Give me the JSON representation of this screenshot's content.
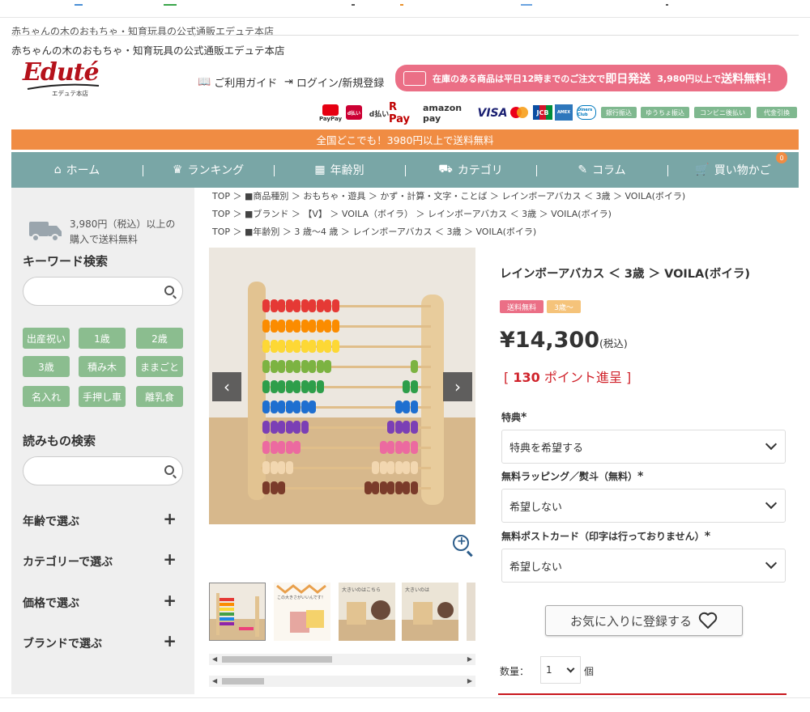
{
  "header": {
    "tagline_faint": "赤ちゃんの木のおもちゃ・知育玩具の公式通販エデュテ本店",
    "tagline": "赤ちゃんの木のおもちゃ・知育玩具の公式通販エデュテ本店",
    "logo_text": "Eduté",
    "logo_sub": "エデュテ本店",
    "guide_link": "ご利用ガイド",
    "login_link": "ログイン/新規登録",
    "promo": {
      "part1": "在庫のある商品は平日12時までのご注文で",
      "part2": "即日発送",
      "part3": "3,980円以上で",
      "part4": "送料無料！"
    },
    "payments": [
      "PayPay",
      "d払い",
      "d払い",
      "R Pay",
      "amazon pay",
      "VISA",
      "mastercard",
      "JCB",
      "AMEX",
      "Diners Club"
    ],
    "payment_badges": [
      "銀行振込",
      "ゆうちょ振込",
      "コンビニ後払い",
      "代金引換"
    ]
  },
  "shipping_banner": "全国どこでも！3980円以上で送料無料",
  "nav": {
    "items": [
      {
        "label": "ホーム",
        "icon": "home-icon"
      },
      {
        "label": "ランキング",
        "icon": "crown-icon"
      },
      {
        "label": "年齢別",
        "icon": "calendar-icon"
      },
      {
        "label": "カテゴリ",
        "icon": "truck-icon"
      },
      {
        "label": "コラム",
        "icon": "pencil-icon"
      },
      {
        "label": "買い物かご",
        "icon": "cart-icon"
      }
    ],
    "cart_count": "0"
  },
  "sidebar": {
    "shipping_note_1": "3,980円（税込）以上の",
    "shipping_note_2": "購入で送料無料",
    "keyword_heading": "キーワード検索",
    "keyword_placeholder": "",
    "tags": [
      "出産祝い",
      "1歳",
      "2歳",
      "3歳",
      "積み木",
      "ままごと",
      "名入れ",
      "手押し車",
      "離乳食"
    ],
    "reading_heading": "読みもの検索",
    "reading_placeholder": "",
    "accordions": [
      "年齢で選ぶ",
      "カテゴリーで選ぶ",
      "価格で選ぶ",
      "ブランドで選ぶ"
    ]
  },
  "breadcrumbs": [
    "TOP ＞ ■商品種別 ＞ おもちゃ・遊具 ＞ かず・計算・文字・ことば ＞ レインボーアバカス ＜ 3歳 ＞ VOILA(ボイラ)",
    "TOP ＞ ■ブランド ＞ 【V】 ＞ VOILA（ボイラ） ＞ レインボーアバカス ＜ 3歳 ＞ VOILA(ボイラ)",
    "TOP ＞ ■年齢別 ＞ 3 歳～4 歳 ＞ レインボーアバカス ＜ 3歳 ＞ VOILA(ボイラ)"
  ],
  "product": {
    "title": "レインボーアバカス ＜ 3歳 ＞ VOILA(ボイラ)",
    "badge_free_shipping": "送料無料",
    "badge_age": "3歳～",
    "price": "¥14,300",
    "tax_note": "(税込)",
    "points_open": "[",
    "points_value": "130",
    "points_label": "ポイント進呈",
    "points_close": "]",
    "option1_label": "特典",
    "option1_value": "特典を希望する",
    "option2_label": "無料ラッピング／熨斗（無料）",
    "option2_value": "希望しない",
    "option3_label": "無料ポストカード（印字は行っておりません）",
    "option3_value": "希望しない",
    "required_mark": "*",
    "favorite_button": "お気に入りに登録する",
    "qty_label": "数量：",
    "qty_value": "1",
    "qty_unit": "個",
    "thumb_texts": [
      "この大きさがいいんです！",
      "大きいのはこちら",
      "大きいのは"
    ]
  },
  "colors": {
    "nav_bg": "#79a6a6",
    "orange_banner": "#f08c43",
    "promo_pink": "#eb6f86",
    "tag_green": "#8bbd8f",
    "points_red": "#d0232b"
  }
}
